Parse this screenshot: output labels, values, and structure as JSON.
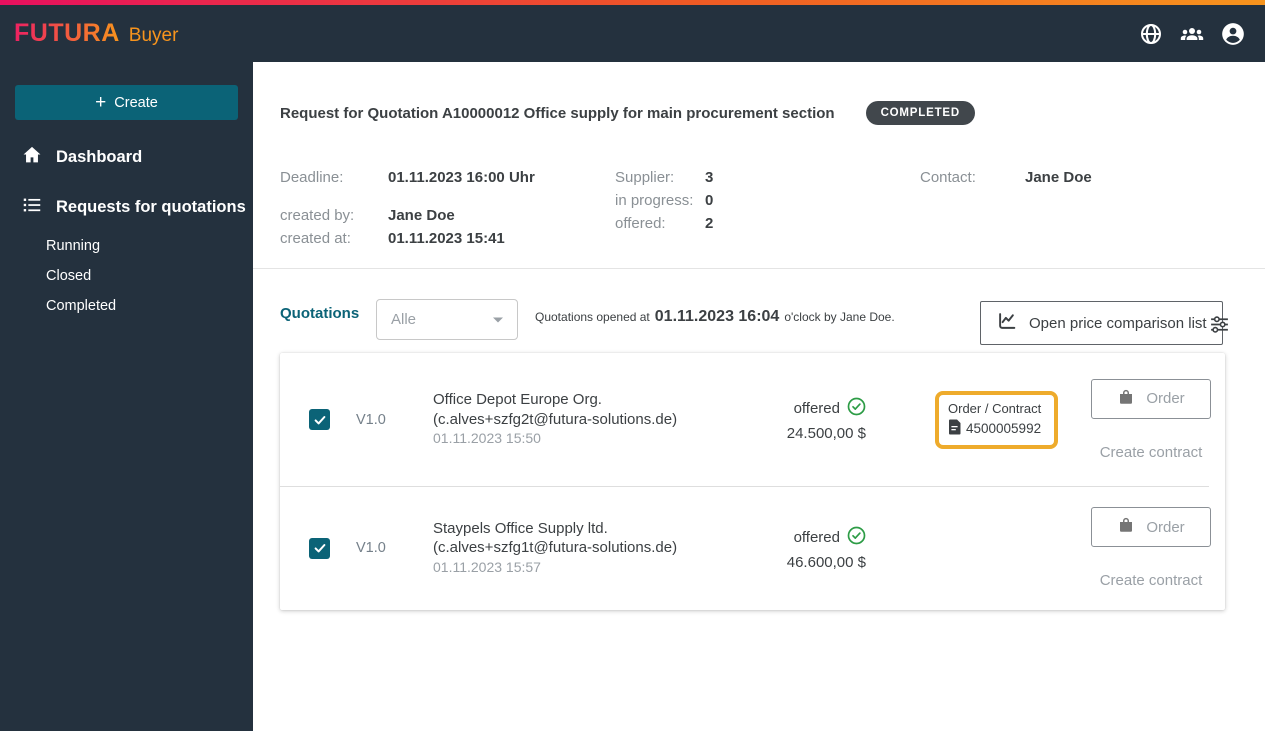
{
  "colors": {
    "topbar_dark": "#24313e",
    "accent_pink": "#e8105f",
    "accent_orange": "#f7941d",
    "teal": "#0b6377",
    "badge_gray": "#41474c",
    "highlight_border": "#eeab2c",
    "status_green": "#2d9c46"
  },
  "header": {
    "brand": "FUTURA",
    "product": "Buyer",
    "icons": [
      "globe-icon",
      "users-icon",
      "account-icon"
    ]
  },
  "sidebar": {
    "create_button": "Create",
    "nav": [
      {
        "label": "Dashboard",
        "icon": "home-icon"
      },
      {
        "label": "Requests for quotations",
        "icon": "list-icon"
      }
    ],
    "sub_nav": [
      {
        "label": "Running"
      },
      {
        "label": "Closed"
      },
      {
        "label": "Completed"
      }
    ]
  },
  "request": {
    "title": "Request for Quotation A10000012 Office supply for main procurement section",
    "status": "COMPLETED",
    "deadline_label": "Deadline:",
    "deadline": "01.11.2023 16:00 Uhr",
    "created_by_label": "created by:",
    "created_by": "Jane Doe",
    "created_at_label": "created at:",
    "created_at": "01.11.2023 15:41",
    "supplier_label": "Supplier:",
    "supplier_count": "3",
    "in_progress_label": "in progress:",
    "in_progress_count": "0",
    "offered_label": "offered:",
    "offered_count": "2",
    "contact_label": "Contact:",
    "contact": "Jane Doe"
  },
  "quotations": {
    "section_label": "Quotations",
    "filter_selected": "Alle",
    "opened_prefix": "Quotations opened at",
    "opened_datetime": "01.11.2023 16:04",
    "opened_suffix": "o'clock by Jane Doe.",
    "price_comparison_button": "Open price comparison list",
    "rows": [
      {
        "version": "V1.0",
        "supplier": "Office Depot Europe Org.",
        "email": "(c.alves+szfg2t@futura-solutions.de)",
        "submitted_at": "01.11.2023 15:50",
        "status": "offered",
        "price": "24.500,00 $",
        "contract_label": "Order / Contract",
        "contract_number": "4500005992",
        "order_button": "Order",
        "create_contract_link": "Create contract"
      },
      {
        "version": "V1.0",
        "supplier": "Staypels Office Supply ltd.",
        "email": "(c.alves+szfg1t@futura-solutions.de)",
        "submitted_at": "01.11.2023 15:57",
        "status": "offered",
        "price": "46.600,00 $",
        "order_button": "Order",
        "create_contract_link": "Create contract"
      }
    ]
  }
}
